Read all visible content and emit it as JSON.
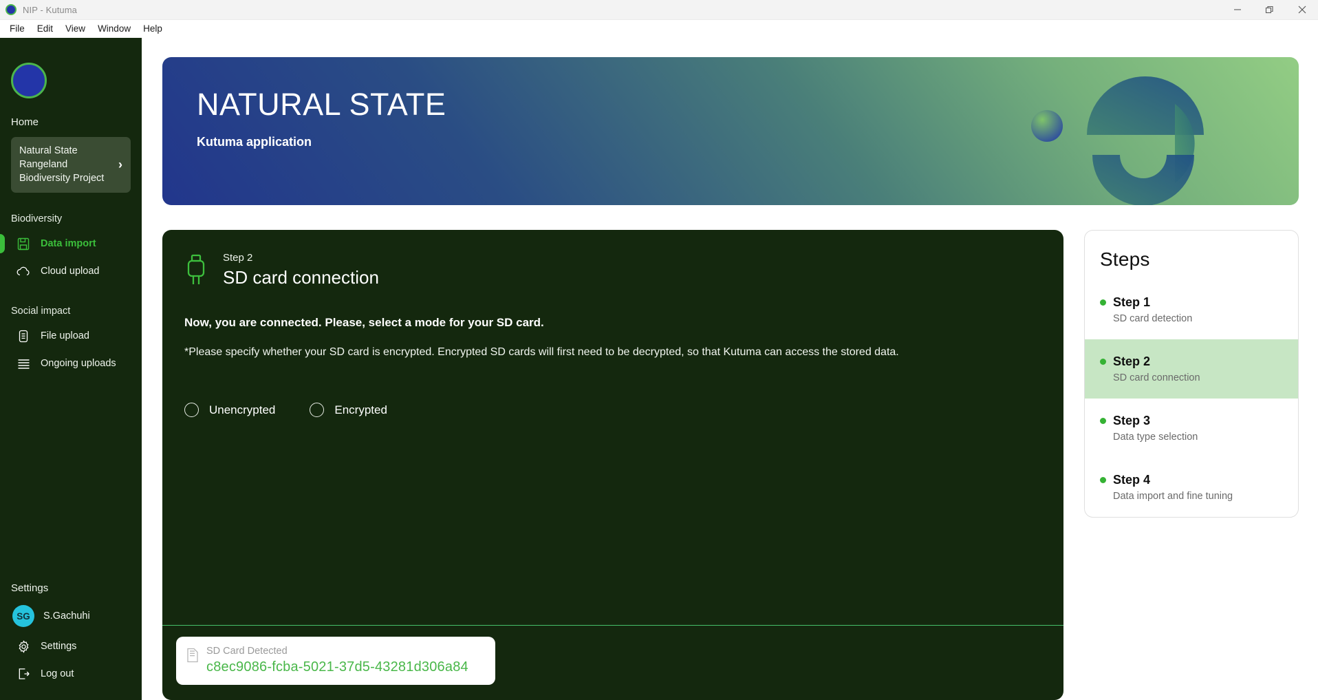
{
  "window": {
    "title": "NIP - Kutuma",
    "controls": {
      "minimize": "minimize",
      "maximize": "restore",
      "close": "close"
    }
  },
  "menubar": {
    "items": [
      "File",
      "Edit",
      "View",
      "Window",
      "Help"
    ]
  },
  "sidebar": {
    "home_label": "Home",
    "project": {
      "name": "Natural State Rangeland Biodiversity Project",
      "chevron": "›"
    },
    "sections": [
      {
        "label": "Biodiversity",
        "items": [
          {
            "label": "Data import",
            "icon": "data-import-icon",
            "active": true
          },
          {
            "label": "Cloud upload",
            "icon": "cloud-upload-icon",
            "active": false
          }
        ]
      },
      {
        "label": "Social impact",
        "items": [
          {
            "label": "File upload",
            "icon": "file-upload-icon",
            "active": false
          },
          {
            "label": "Ongoing uploads",
            "icon": "list-icon",
            "active": false
          }
        ]
      }
    ],
    "settings_label": "Settings",
    "user": {
      "initials": "SG",
      "name": "S.Gachuhi",
      "avatar_color": "#25c3dd"
    },
    "bottom_items": [
      {
        "label": "Settings",
        "icon": "gear-icon"
      },
      {
        "label": "Log out",
        "icon": "logout-icon"
      }
    ]
  },
  "hero": {
    "title": "NATURAL STATE",
    "subtitle": "Kutuma application",
    "gradient_from": "#22368c",
    "gradient_to": "#93cd84"
  },
  "step_card": {
    "icon": "usb-plug-icon",
    "eyebrow": "Step 2",
    "heading": "SD card connection",
    "lead": "Now, you are connected. Please, select a mode for your SD card.",
    "note": "*Please specify whether your SD card is encrypted. Encrypted SD cards will first need to be decrypted, so that Kutuma can access the stored data.",
    "options": [
      {
        "label": "Unencrypted",
        "selected": false
      },
      {
        "label": "Encrypted",
        "selected": false
      }
    ],
    "detected": {
      "icon": "sd-card-icon",
      "label": "SD Card Detected",
      "uuid": "c8ec9086-fcba-5021-37d5-43281d306a84",
      "uuid_color": "#49b749"
    },
    "background": "#14280e",
    "divider_color": "#46c26a"
  },
  "steps_panel": {
    "title": "Steps",
    "highlight_color": "#c7e6c4",
    "bullet_color": "#35b234",
    "steps": [
      {
        "title": "Step 1",
        "desc": "SD card detection",
        "current": false
      },
      {
        "title": "Step 2",
        "desc": "SD card connection",
        "current": true
      },
      {
        "title": "Step 3",
        "desc": "Data type selection",
        "current": false
      },
      {
        "title": "Step 4",
        "desc": "Data import and fine tuning",
        "current": false
      }
    ]
  }
}
